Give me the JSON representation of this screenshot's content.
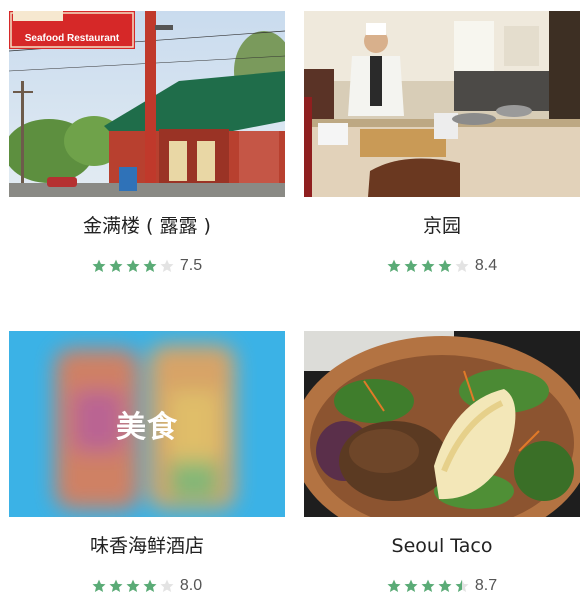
{
  "colors": {
    "star_filled": "#5aab76",
    "star_empty": "#e3e3e3",
    "placeholder_bg": "#3bb2e6"
  },
  "restaurants": [
    {
      "name": "金满楼 ( 露露 )",
      "rating": 3.75,
      "score": "7.5",
      "photo": "photo-restaurant-exterior",
      "sign_text": "Seafood Restaurant"
    },
    {
      "name": "京园",
      "rating": 4.2,
      "score": "8.4",
      "photo": "photo-chef-kitchen"
    },
    {
      "name": "味香海鲜酒店",
      "rating": 4.0,
      "score": "8.0",
      "photo": "placeholder-food",
      "placeholder_label": "美食"
    },
    {
      "name": "Seoul Taco",
      "rating": 4.35,
      "score": "8.7",
      "photo": "photo-salad-bowl"
    }
  ]
}
